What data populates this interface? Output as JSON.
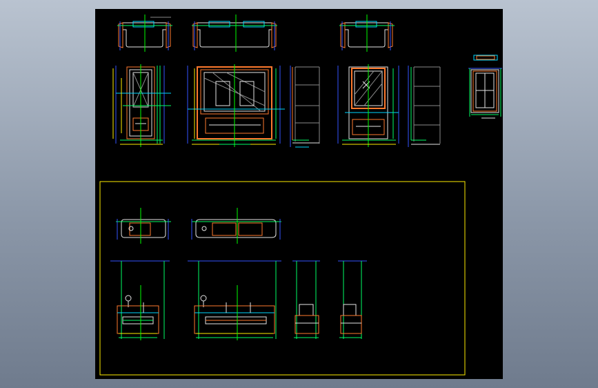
{
  "canvas": {
    "background": "#000000",
    "surround": "#9aa5b4"
  },
  "layer_colors": {
    "outline": "#ff7a2e",
    "dimension": "#00ff66",
    "center": "#00ff00",
    "blue": "#3355ff",
    "cyan": "#00d8ff",
    "white": "#e6e6e6",
    "magenta": "#ff44ff",
    "yellow": "#ffee00",
    "grey": "#8a8a8a"
  },
  "drawing_groups": {
    "upper": "elevation-and-plan-views",
    "lower_frame": "yellow-border-detail-sheet"
  }
}
